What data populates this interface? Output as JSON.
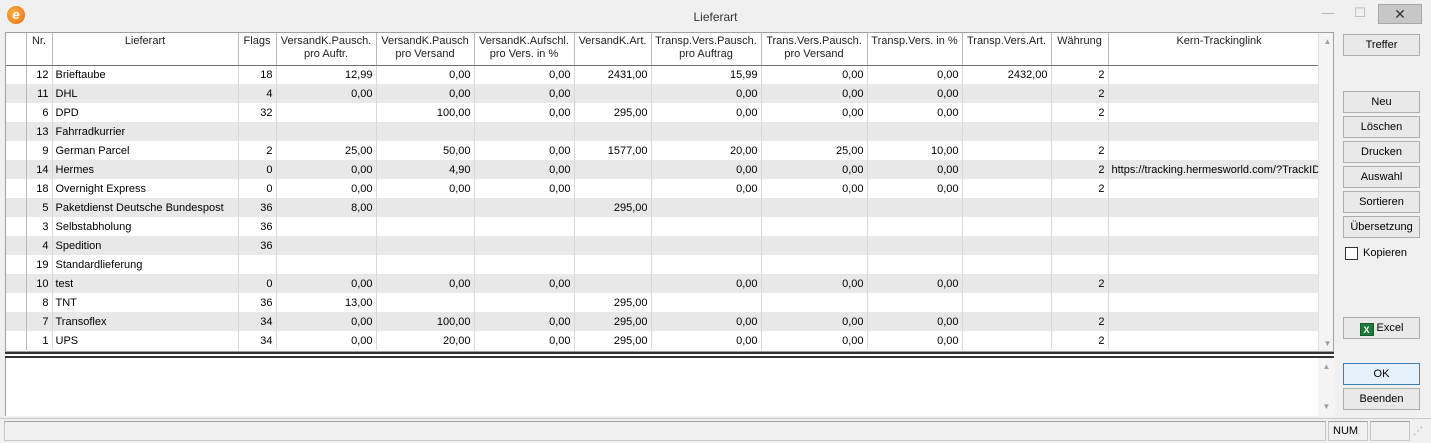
{
  "window": {
    "title": "Lieferart"
  },
  "columns": [
    {
      "key": "sel",
      "label": ""
    },
    {
      "key": "nr",
      "label": "Nr."
    },
    {
      "key": "name",
      "label": "Lieferart"
    },
    {
      "key": "flags",
      "label": "Flags"
    },
    {
      "key": "va",
      "label": "VersandK.Pausch.\npro Auftr."
    },
    {
      "key": "vv",
      "label": "VersandK.Pausch\npro Versand"
    },
    {
      "key": "vauf",
      "label": "VersandK.Aufschl.\npro Vers. in %"
    },
    {
      "key": "vart",
      "label": "VersandK.Art."
    },
    {
      "key": "tpa",
      "label": "Transp.Vers.Pausch.\npro Auftrag"
    },
    {
      "key": "tpv",
      "label": "Trans.Vers.Pausch.\npro Versand"
    },
    {
      "key": "tp",
      "label": "Transp.Vers. in %"
    },
    {
      "key": "tart",
      "label": "Transp.Vers.Art."
    },
    {
      "key": "wae",
      "label": "Währung"
    },
    {
      "key": "link",
      "label": "Kern-Trackinglink"
    }
  ],
  "rows": [
    {
      "nr": "12",
      "name": "Brieftaube",
      "flags": "18",
      "va": "12,99",
      "vv": "0,00",
      "vauf": "0,00",
      "vart": "2431,00",
      "tpa": "15,99",
      "tpv": "0,00",
      "tp": "0,00",
      "tart": "2432,00",
      "wae": "2",
      "link": ""
    },
    {
      "nr": "11",
      "name": "DHL",
      "flags": "4",
      "va": "0,00",
      "vv": "0,00",
      "vauf": "0,00",
      "vart": "",
      "tpa": "0,00",
      "tpv": "0,00",
      "tp": "0,00",
      "tart": "",
      "wae": "2",
      "link": ""
    },
    {
      "nr": "6",
      "name": "DPD",
      "flags": "32",
      "va": "",
      "vv": "100,00",
      "vauf": "0,00",
      "vart": "295,00",
      "tpa": "0,00",
      "tpv": "0,00",
      "tp": "0,00",
      "tart": "",
      "wae": "2",
      "link": ""
    },
    {
      "nr": "13",
      "name": "Fahrradkurrier",
      "flags": "",
      "va": "",
      "vv": "",
      "vauf": "",
      "vart": "",
      "tpa": "",
      "tpv": "",
      "tp": "",
      "tart": "",
      "wae": "",
      "link": ""
    },
    {
      "nr": "9",
      "name": "German Parcel",
      "flags": "2",
      "va": "25,00",
      "vv": "50,00",
      "vauf": "0,00",
      "vart": "1577,00",
      "tpa": "20,00",
      "tpv": "25,00",
      "tp": "10,00",
      "tart": "",
      "wae": "2",
      "link": ""
    },
    {
      "nr": "14",
      "name": "Hermes",
      "flags": "0",
      "va": "0,00",
      "vv": "4,90",
      "vauf": "0,00",
      "vart": "",
      "tpa": "0,00",
      "tpv": "0,00",
      "tp": "0,00",
      "tart": "",
      "wae": "2",
      "link": "https://tracking.hermesworld.com/?TrackID="
    },
    {
      "nr": "18",
      "name": "Overnight Express",
      "flags": "0",
      "va": "0,00",
      "vv": "0,00",
      "vauf": "0,00",
      "vart": "",
      "tpa": "0,00",
      "tpv": "0,00",
      "tp": "0,00",
      "tart": "",
      "wae": "2",
      "link": ""
    },
    {
      "nr": "5",
      "name": "Paketdienst Deutsche Bundespost",
      "flags": "36",
      "va": "8,00",
      "vv": "",
      "vauf": "",
      "vart": "295,00",
      "tpa": "",
      "tpv": "",
      "tp": "",
      "tart": "",
      "wae": "",
      "link": ""
    },
    {
      "nr": "3",
      "name": "Selbstabholung",
      "flags": "36",
      "va": "",
      "vv": "",
      "vauf": "",
      "vart": "",
      "tpa": "",
      "tpv": "",
      "tp": "",
      "tart": "",
      "wae": "",
      "link": ""
    },
    {
      "nr": "4",
      "name": "Spedition",
      "flags": "36",
      "va": "",
      "vv": "",
      "vauf": "",
      "vart": "",
      "tpa": "",
      "tpv": "",
      "tp": "",
      "tart": "",
      "wae": "",
      "link": ""
    },
    {
      "nr": "19",
      "name": "Standardlieferung",
      "flags": "",
      "va": "",
      "vv": "",
      "vauf": "",
      "vart": "",
      "tpa": "",
      "tpv": "",
      "tp": "",
      "tart": "",
      "wae": "",
      "link": ""
    },
    {
      "nr": "10",
      "name": "test",
      "flags": "0",
      "va": "0,00",
      "vv": "0,00",
      "vauf": "0,00",
      "vart": "",
      "tpa": "0,00",
      "tpv": "0,00",
      "tp": "0,00",
      "tart": "",
      "wae": "2",
      "link": ""
    },
    {
      "nr": "8",
      "name": "TNT",
      "flags": "36",
      "va": "13,00",
      "vv": "",
      "vauf": "",
      "vart": "295,00",
      "tpa": "",
      "tpv": "",
      "tp": "",
      "tart": "",
      "wae": "",
      "link": ""
    },
    {
      "nr": "7",
      "name": "Transoflex",
      "flags": "34",
      "va": "0,00",
      "vv": "100,00",
      "vauf": "0,00",
      "vart": "295,00",
      "tpa": "0,00",
      "tpv": "0,00",
      "tp": "0,00",
      "tart": "",
      "wae": "2",
      "link": ""
    },
    {
      "nr": "1",
      "name": "UPS",
      "flags": "34",
      "va": "0,00",
      "vv": "20,00",
      "vauf": "0,00",
      "vart": "295,00",
      "tpa": "0,00",
      "tpv": "0,00",
      "tp": "0,00",
      "tart": "",
      "wae": "2",
      "link": ""
    }
  ],
  "buttons": {
    "treffer": "Treffer",
    "neu": "Neu",
    "loeschen": "Löschen",
    "drucken": "Drucken",
    "auswahl": "Auswahl",
    "sortieren": "Sortieren",
    "uebersetzung": "Übersetzung",
    "excel": "Excel",
    "ok": "OK",
    "beenden": "Beenden"
  },
  "checkbox": {
    "kopieren_label": "Kopieren",
    "kopieren_checked": false
  },
  "status": {
    "pane_1": "",
    "num": "NUM",
    "pane_3": ""
  },
  "icons": {
    "app": "app-logo-icon",
    "excel": "excel-icon"
  },
  "colors": {
    "row_alt": "#e8e8e8",
    "ok_border": "#3c7fb1"
  }
}
